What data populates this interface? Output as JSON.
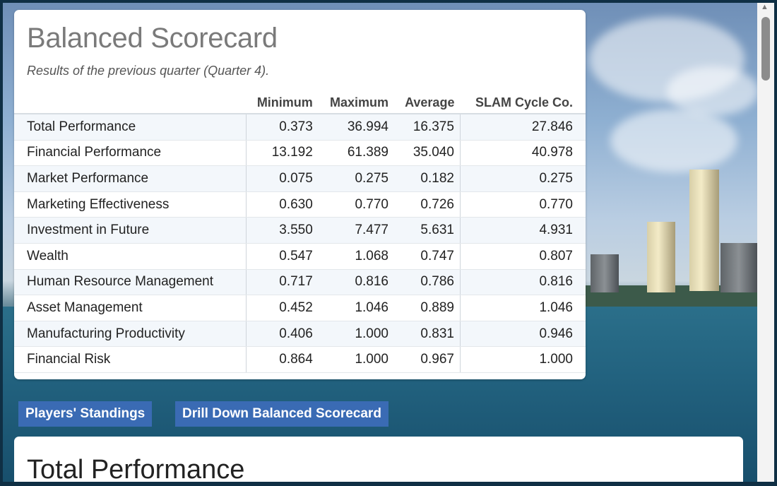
{
  "scorecard": {
    "title": "Balanced Scorecard",
    "subtitle": "Results of the previous quarter (Quarter 4).",
    "columns": [
      "",
      "Minimum",
      "Maximum",
      "Average",
      "SLAM Cycle Co."
    ],
    "rows": [
      [
        "Total Performance",
        "0.373",
        "36.994",
        "16.375",
        "27.846"
      ],
      [
        "Financial Performance",
        "13.192",
        "61.389",
        "35.040",
        "40.978"
      ],
      [
        "Market Performance",
        "0.075",
        "0.275",
        "0.182",
        "0.275"
      ],
      [
        "Marketing Effectiveness",
        "0.630",
        "0.770",
        "0.726",
        "0.770"
      ],
      [
        "Investment in Future",
        "3.550",
        "7.477",
        "5.631",
        "4.931"
      ],
      [
        "Wealth",
        "0.547",
        "1.068",
        "0.747",
        "0.807"
      ],
      [
        "Human Resource Management",
        "0.717",
        "0.816",
        "0.786",
        "0.816"
      ],
      [
        "Asset Management",
        "0.452",
        "1.046",
        "0.889",
        "1.046"
      ],
      [
        "Manufacturing Productivity",
        "0.406",
        "1.000",
        "0.831",
        "0.946"
      ],
      [
        "Financial Risk",
        "0.864",
        "1.000",
        "0.967",
        "1.000"
      ]
    ]
  },
  "buttons": {
    "standings": "Players' Standings",
    "drilldown": "Drill Down Balanced Scorecard"
  },
  "section2": {
    "title": "Total Performance"
  },
  "colors": {
    "button": "#3a6bb4",
    "frame": "#0f2f44"
  }
}
